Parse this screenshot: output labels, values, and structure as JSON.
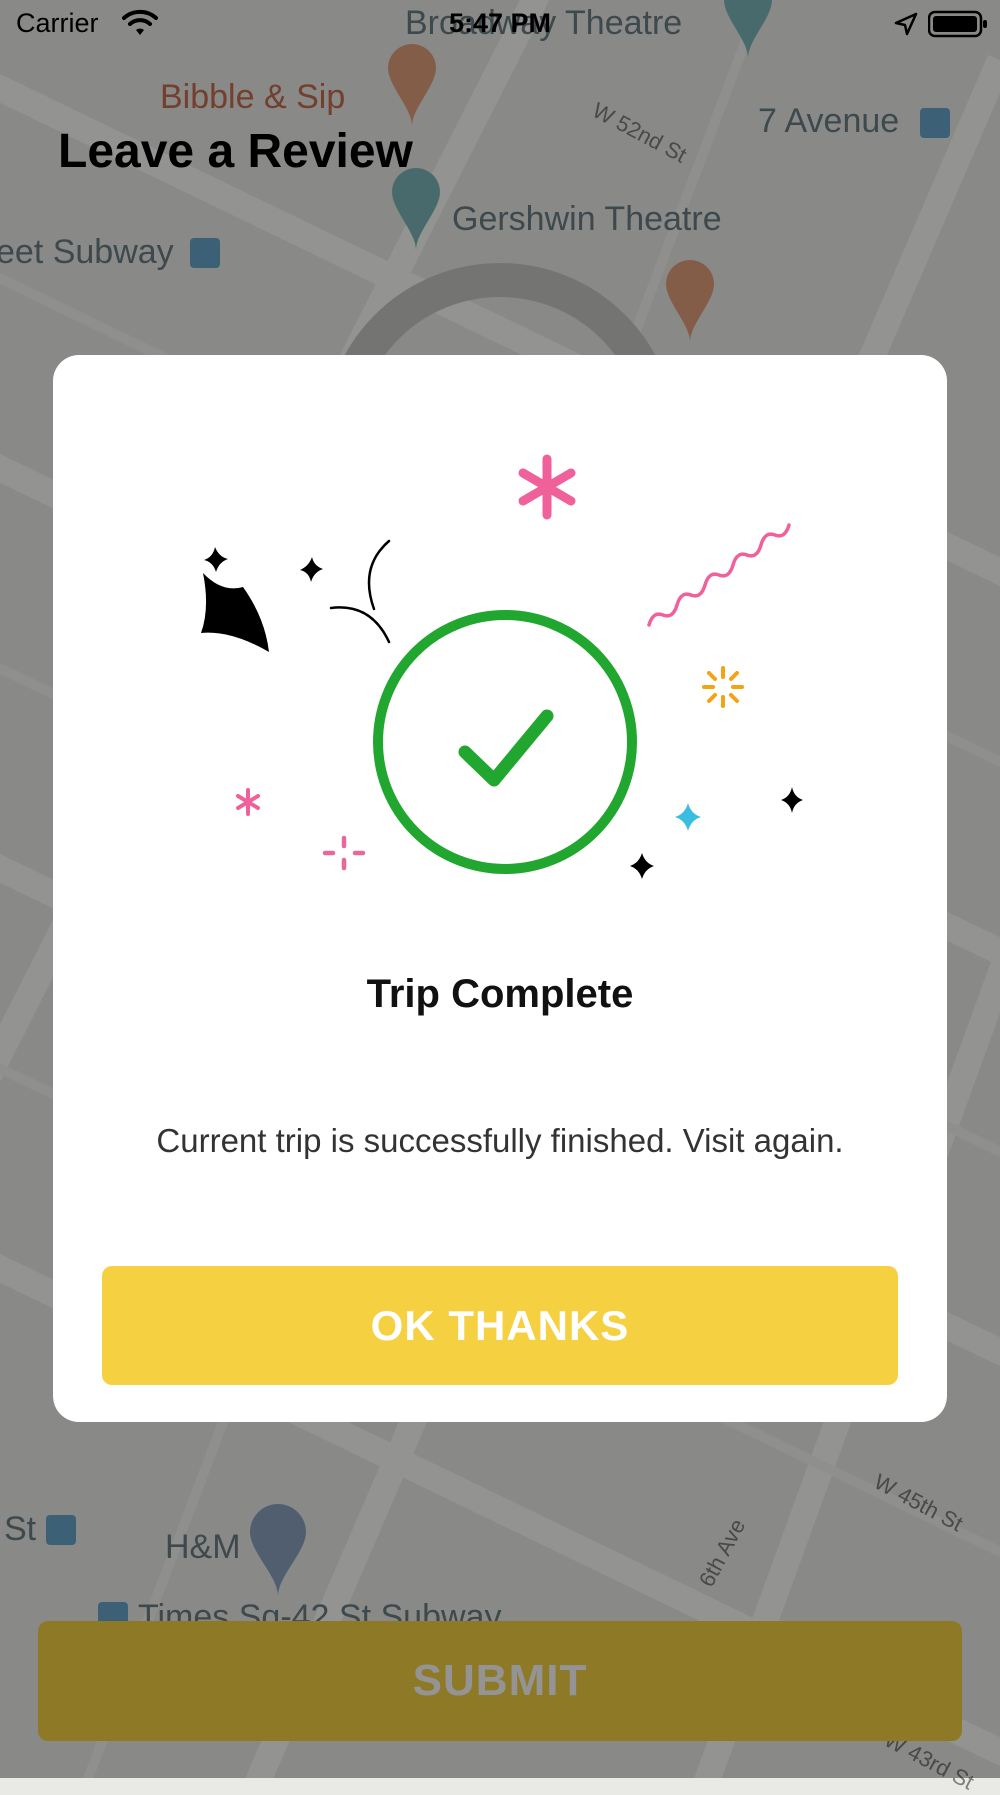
{
  "status_bar": {
    "carrier": "Carrier",
    "time": "5:47 PM"
  },
  "map": {
    "labels": [
      {
        "text": "Bibble & Sip"
      },
      {
        "text": "Broadway Theatre"
      },
      {
        "text": "7 Avenue"
      },
      {
        "text": "Gershwin Theatre"
      },
      {
        "text": "eet Subway"
      },
      {
        "text": "H&M"
      },
      {
        "text": "St"
      },
      {
        "text": "Times Sq-42 St Subway"
      }
    ],
    "streets": [
      "W 52nd St",
      "W 45th St",
      "6th Ave",
      "W 43rd St"
    ]
  },
  "page": {
    "title": "Leave a Review",
    "submit_label": "SUBMIT"
  },
  "modal": {
    "title": "Trip Complete",
    "message": "Current trip is successfully finished. Visit again.",
    "button_label": "OK THANKS"
  },
  "colors": {
    "accent_yellow": "#f5d142",
    "success_green": "#21a62f",
    "confetti_pink": "#f0609a",
    "confetti_orange": "#f5a214",
    "confetti_cyan": "#39bde0"
  }
}
